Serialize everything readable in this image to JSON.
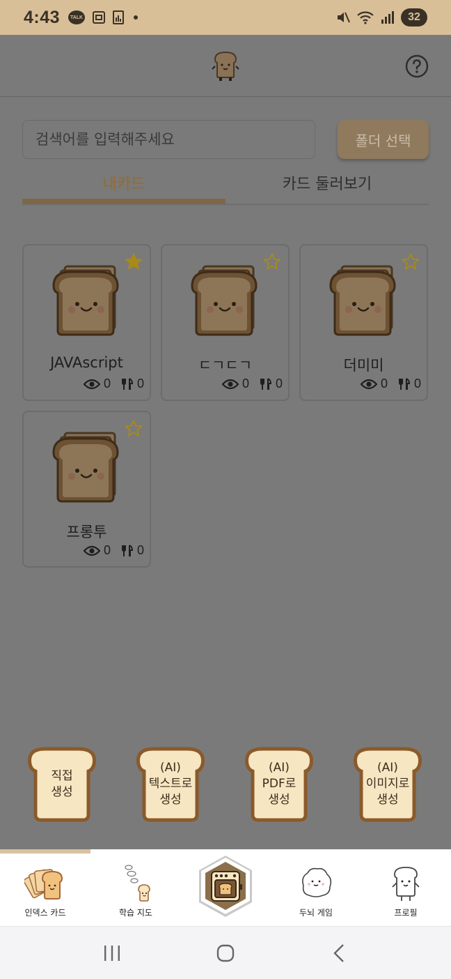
{
  "status_bar": {
    "time": "4:43",
    "talk_badge": "TALK",
    "battery": "32"
  },
  "search": {
    "placeholder": "검색어를 입력해주세요",
    "value": ""
  },
  "folder_button": "폴더 선택",
  "tabs": [
    {
      "label": "내카드",
      "active": true
    },
    {
      "label": "카드 둘러보기",
      "active": false
    }
  ],
  "cards": [
    {
      "title": "JAVAscript",
      "views": "0",
      "forks": "0",
      "starred": true
    },
    {
      "title": "ㄷㄱㄷㄱ",
      "views": "0",
      "forks": "0",
      "starred": false
    },
    {
      "title": "더미미",
      "views": "0",
      "forks": "0",
      "starred": false
    },
    {
      "title": "프롱투",
      "views": "0",
      "forks": "0",
      "starred": false
    }
  ],
  "create_buttons": [
    {
      "lines": [
        "직접",
        "생성"
      ]
    },
    {
      "lines": [
        "(AI)",
        "텍스트로",
        "생성"
      ]
    },
    {
      "lines": [
        "(AI)",
        "PDF로",
        "생성"
      ]
    },
    {
      "lines": [
        "(AI)",
        "이미지로",
        "생성"
      ]
    }
  ],
  "bottom_nav": [
    {
      "label": "인덱스 카드",
      "icon": "index-cards-icon"
    },
    {
      "label": "학습 지도",
      "icon": "study-map-icon"
    },
    {
      "label": "",
      "icon": "oven-icon"
    },
    {
      "label": "두뇌 게임",
      "icon": "brain-game-icon"
    },
    {
      "label": "프로필",
      "icon": "profile-toast-icon"
    }
  ],
  "colors": {
    "brand_tan": "#d9bf98",
    "tab_active": "#8c6f45",
    "star_filled": "#a88a1a",
    "overlay": "#7a7a7a"
  }
}
